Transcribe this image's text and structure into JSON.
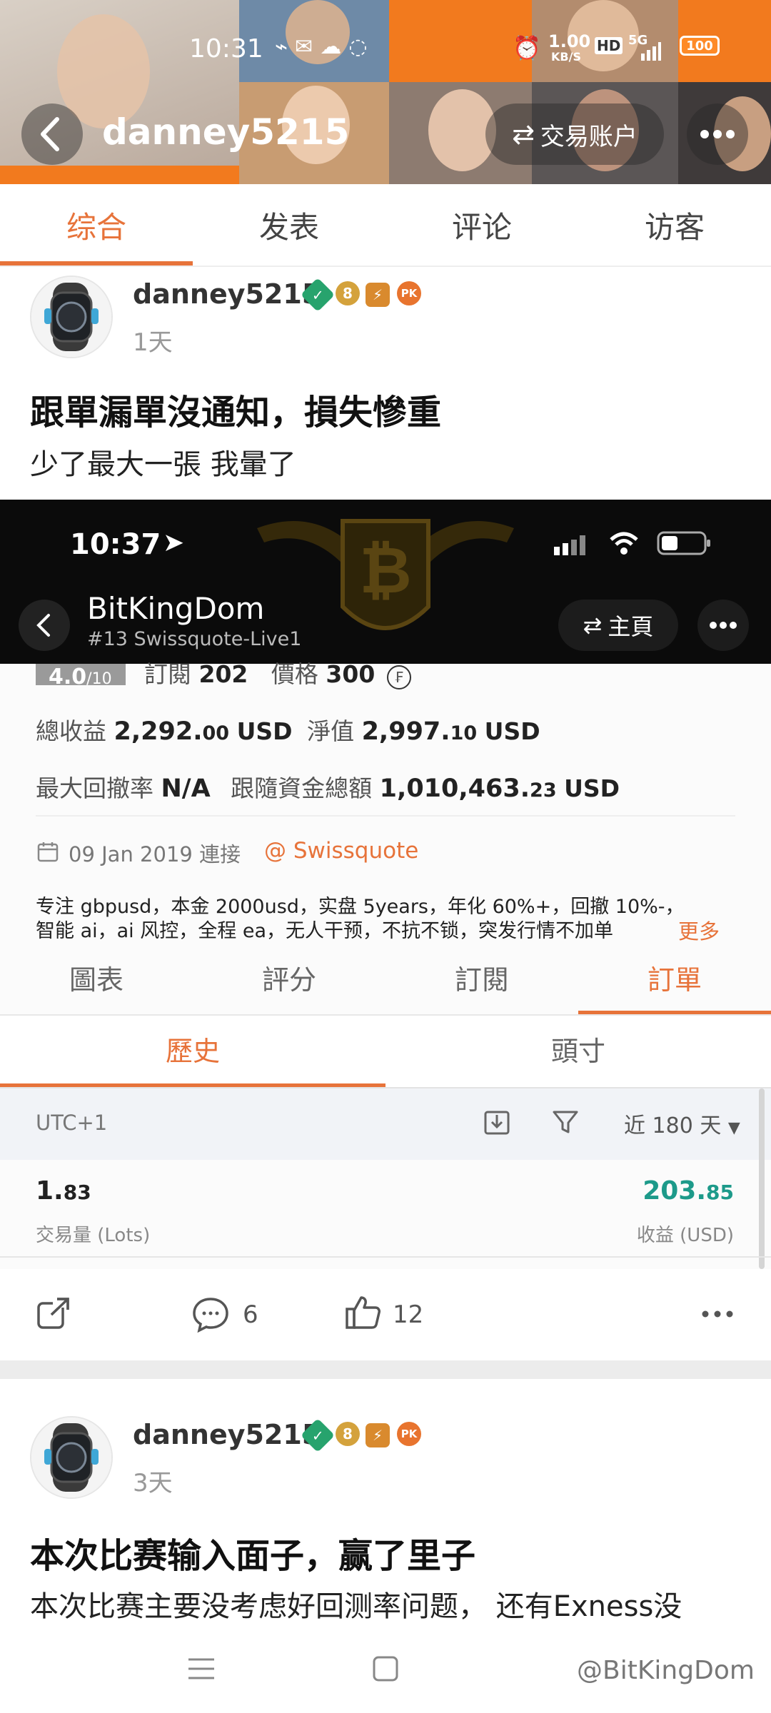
{
  "status_bar": {
    "time": "10:31",
    "net_speed_value": "1.00",
    "net_speed_unit": "KB/S",
    "hd": "HD",
    "signal": "5G",
    "battery": "100"
  },
  "header": {
    "username": "danney5215",
    "trading_account_label": "交易账户"
  },
  "tabs": [
    "综合",
    "发表",
    "评论",
    "访客"
  ],
  "posts": [
    {
      "username": "danney5215",
      "time_ago": "1天",
      "title": "跟單漏單沒通知，損失慘重",
      "body": "少了最大一張 我暈了",
      "comments": "6",
      "likes": "12"
    },
    {
      "username": "danney5215",
      "time_ago": "3天",
      "title": "本次比赛输入面子，赢了里子",
      "body": "本次比赛主要没考虑好回测率问题， 还有Exness没"
    }
  ],
  "embed": {
    "status_time": "10:37",
    "app_title": "BitKingDom",
    "account_sub": "#13 Swissquote-Live1",
    "home_label": "主頁",
    "rating": "4.0",
    "rating_max": "/10",
    "subscribe_label": "訂閱",
    "subscribe_value": "202",
    "price_label": "價格",
    "price_value": "300",
    "total_profit_label": "總收益",
    "total_profit_int": "2,292.",
    "total_profit_dec": "00",
    "total_profit_cur": "USD",
    "equity_label": "淨值",
    "equity_int": "2,997.",
    "equity_dec": "10",
    "equity_cur": "USD",
    "max_drawdown_label": "最大回撤率",
    "max_drawdown_value": "N/A",
    "follow_funds_label": "跟隨資金總額",
    "follow_funds_int": "1,010,463.",
    "follow_funds_dec": "23",
    "follow_funds_cur": "USD",
    "connect_date": "09 Jan 2019 連接",
    "broker": "@ Swissquote",
    "description_line1": "专注 gbpusd，本金 2000usd，实盘 5years，年化 60%+，回撤 10%-，",
    "description_line2": "智能 ai，ai 风控，全程 ea，无人干预，不抗不锁，突发行情不加单",
    "more_label": "更多",
    "tabs": [
      "圖表",
      "評分",
      "訂閱",
      "訂單"
    ],
    "subtabs": [
      "歷史",
      "頭寸"
    ],
    "timezone": "UTC+1",
    "range_label": "近 180 天",
    "lots_int": "1.",
    "lots_dec": "83",
    "lots_label": "交易量 (Lots)",
    "profit_int": "203.",
    "profit_dec": "85",
    "profit_label": "收益 (USD)"
  },
  "watermark": "@BitKingDom",
  "colors": {
    "accent": "#e7733a",
    "profit_green": "#1d9a8a",
    "badge_green": "#27a36d",
    "badge_gold": "#d4a23c",
    "badge_orange": "#e8742e"
  }
}
